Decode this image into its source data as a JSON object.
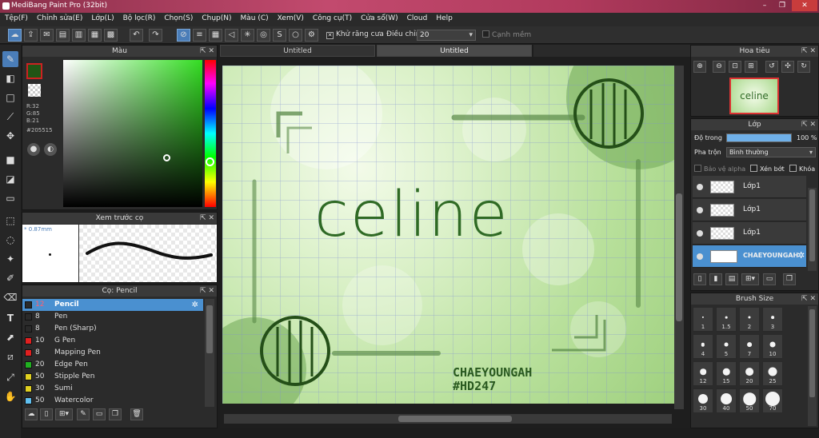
{
  "app": {
    "title": "MediBang Paint Pro (32bit)",
    "win_min": "–",
    "win_max": "❐",
    "win_close": "✕"
  },
  "menu": [
    "Tệp(F)",
    "Chỉnh sửa(E)",
    "Lớp(L)",
    "Bộ lọc(R)",
    "Chọn(S)",
    "Chụp(N)",
    "Màu (C)",
    "Xem(V)",
    "Công cụ(T)",
    "Cửa sổ(W)",
    "Cloud",
    "Help"
  ],
  "toolbar": {
    "antialias_label": "Khử răng cưa",
    "adjust_label": "Điều chỉnh",
    "adjust_value": "20",
    "smooth_label": "Cạnh mềm"
  },
  "color_panel": {
    "title": "Màu",
    "r": "R:32",
    "g": "G:85",
    "b": "B:21",
    "hex": "#205515",
    "fg_color": "#205515"
  },
  "brush_preview": {
    "title": "Xem trước cọ",
    "size": "0.87mm"
  },
  "brush_panel": {
    "title": "Cọ: Pencil",
    "items": [
      {
        "size": "12",
        "name": "Pencil",
        "color": "#2a2a2a"
      },
      {
        "size": "8",
        "name": "Pen",
        "color": "#2a2a2a"
      },
      {
        "size": "8",
        "name": "Pen (Sharp)",
        "color": "#2a2a2a"
      },
      {
        "size": "10",
        "name": "G Pen",
        "color": "#e02020"
      },
      {
        "size": "8",
        "name": "Mapping Pen",
        "color": "#e02020"
      },
      {
        "size": "20",
        "name": "Edge Pen",
        "color": "#20b020"
      },
      {
        "size": "50",
        "name": "Stipple Pen",
        "color": "#e0d020"
      },
      {
        "size": "30",
        "name": "Sumi",
        "color": "#e0d020"
      },
      {
        "size": "50",
        "name": "Watercolor",
        "color": "#60c0f0"
      }
    ]
  },
  "canvas": {
    "tabs": [
      "Untitled",
      "Untitled"
    ],
    "art_title": "celine",
    "signature_line1": "CHAEYOUNGAH",
    "signature_line2": "#HD247"
  },
  "navigator": {
    "title": "Hoa tiêu",
    "thumb_text": "celine"
  },
  "layers": {
    "title": "Lớp",
    "opacity_label": "Độ trong",
    "opacity_value": "100 %",
    "opacity": 1.0,
    "blend_label": "Pha trộn",
    "blend_value": "Bình thường",
    "protect_alpha": "Bảo vệ alpha",
    "clipping": "Xén bớt",
    "lock": "Khóa",
    "items": [
      {
        "name": "Lớp1"
      },
      {
        "name": "Lớp1"
      },
      {
        "name": "Lớp1"
      },
      {
        "name": "CHAEYOUNGAH"
      }
    ]
  },
  "brush_size": {
    "title": "Brush Size",
    "values": [
      "1",
      "1.5",
      "2",
      "3",
      "4",
      "5",
      "7",
      "10",
      "12",
      "15",
      "20",
      "25",
      "30",
      "40",
      "50",
      "70"
    ]
  }
}
